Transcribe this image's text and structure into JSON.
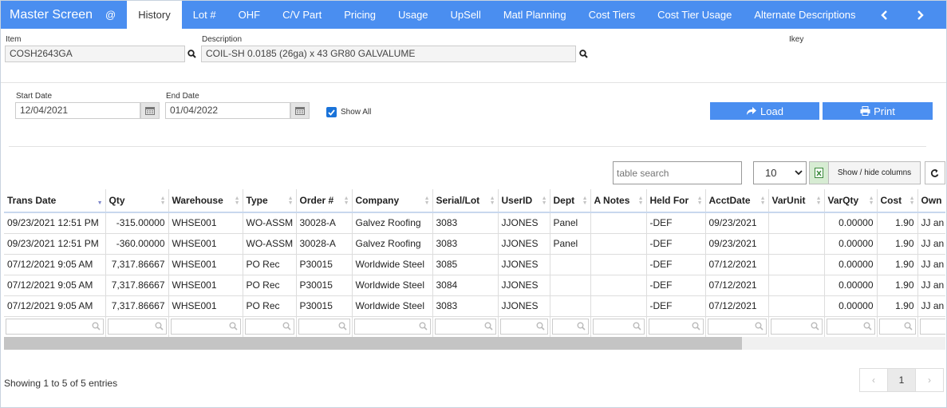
{
  "nav": {
    "brand": "Master Screen",
    "tabs": [
      {
        "label": "@"
      },
      {
        "label": "History",
        "active": true
      },
      {
        "label": "Lot #"
      },
      {
        "label": "OHF"
      },
      {
        "label": "C/V Part"
      },
      {
        "label": "Pricing"
      },
      {
        "label": "Usage"
      },
      {
        "label": "UpSell"
      },
      {
        "label": "Matl Planning"
      },
      {
        "label": "Cost Tiers"
      },
      {
        "label": "Cost Tier Usage"
      },
      {
        "label": "Alternate Descriptions"
      }
    ]
  },
  "item": {
    "label": "Item",
    "value": "COSH2643GA"
  },
  "description": {
    "label": "Description",
    "value": "COIL-SH 0.0185 (26ga) x 43 GR80 GALVALUME"
  },
  "ikey": {
    "label": "Ikey"
  },
  "filters": {
    "start_label": "Start Date",
    "start_value": "12/04/2021",
    "end_label": "End Date",
    "end_value": "01/04/2022",
    "show_all_label": "Show All"
  },
  "buttons": {
    "load": "Load",
    "print": "Print"
  },
  "table_tools": {
    "search_placeholder": "table search",
    "page_size": "10",
    "show_hide": "Show / hide columns"
  },
  "table": {
    "columns": [
      "Trans Date",
      "Qty",
      "Warehouse",
      "Type",
      "Order #",
      "Company",
      "Serial/Lot",
      "UserID",
      "Dept",
      "A Notes",
      "Held For",
      "AcctDate",
      "VarUnit",
      "VarQty",
      "Cost",
      "Own"
    ],
    "rows": [
      [
        "09/23/2021 12:51 PM",
        "-315.00000",
        "WHSE001",
        "WO-ASSM",
        "30028-A",
        "Galvez Roofing",
        "3083",
        "JJONES",
        "Panel",
        "",
        "-DEF",
        "09/23/2021",
        "",
        "0.00000",
        "1.90",
        "JJ an"
      ],
      [
        "09/23/2021 12:51 PM",
        "-360.00000",
        "WHSE001",
        "WO-ASSM",
        "30028-A",
        "Galvez Roofing",
        "3083",
        "JJONES",
        "Panel",
        "",
        "-DEF",
        "09/23/2021",
        "",
        "0.00000",
        "1.90",
        "JJ an"
      ],
      [
        "07/12/2021 9:05 AM",
        "7,317.86667",
        "WHSE001",
        "PO Rec",
        "P30015",
        "Worldwide Steel",
        "3085",
        "JJONES",
        "",
        "",
        "-DEF",
        "07/12/2021",
        "",
        "0.00000",
        "1.90",
        "JJ an"
      ],
      [
        "07/12/2021 9:05 AM",
        "7,317.86667",
        "WHSE001",
        "PO Rec",
        "P30015",
        "Worldwide Steel",
        "3084",
        "JJONES",
        "",
        "",
        "-DEF",
        "07/12/2021",
        "",
        "0.00000",
        "1.90",
        "JJ an"
      ],
      [
        "07/12/2021 9:05 AM",
        "7,317.86667",
        "WHSE001",
        "PO Rec",
        "P30015",
        "Worldwide Steel",
        "3083",
        "JJONES",
        "",
        "",
        "-DEF",
        "07/12/2021",
        "",
        "0.00000",
        "1.90",
        "JJ an"
      ]
    ]
  },
  "footer": {
    "info": "Showing 1 to 5 of 5 entries",
    "prev": "‹",
    "page": "1",
    "next": "›"
  },
  "colors": {
    "accent": "#4a8ef0",
    "checkbox": "#1a73d9"
  }
}
